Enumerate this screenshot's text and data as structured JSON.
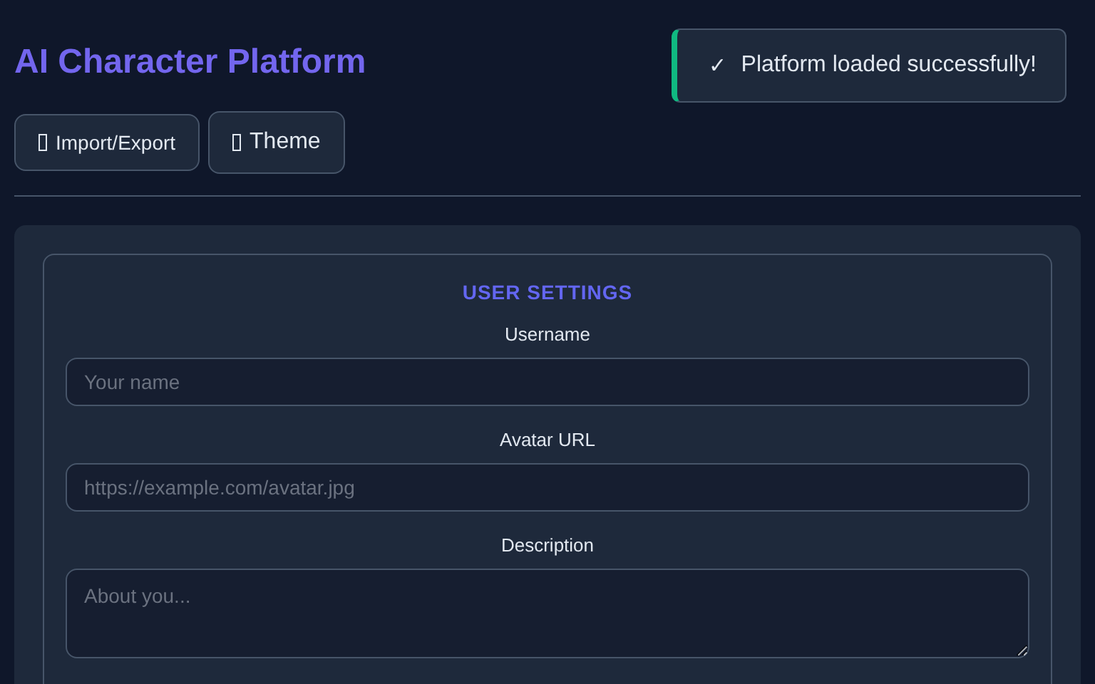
{
  "header": {
    "title": "AI Character Platform"
  },
  "toolbar": [
    {
      "label": "Import/Export",
      "kind": "small"
    },
    {
      "label": "Theme",
      "kind": "large"
    }
  ],
  "toast": {
    "icon": "✓",
    "message": "Platform loaded successfully!"
  },
  "settings": {
    "title": "USER SETTINGS",
    "fields": [
      {
        "label": "Username",
        "placeholder": "Your name",
        "kind": "input"
      },
      {
        "label": "Avatar URL",
        "placeholder": "https://example.com/avatar.jpg",
        "kind": "input"
      },
      {
        "label": "Description",
        "placeholder": "About you...",
        "kind": "textarea"
      }
    ]
  }
}
